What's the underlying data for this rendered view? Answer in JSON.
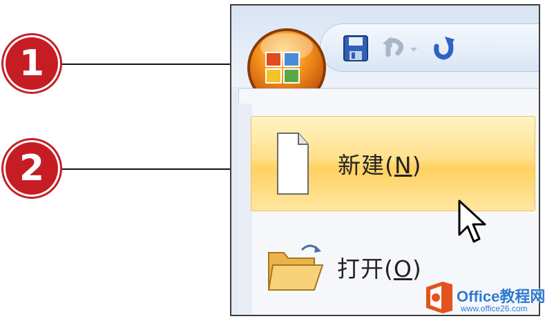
{
  "menu": {
    "items": [
      {
        "label": "新建",
        "accelerator": "N",
        "icon": "blank-document-icon",
        "highlighted": true
      },
      {
        "label": "打开",
        "accelerator": "O",
        "icon": "open-folder-icon",
        "highlighted": false
      }
    ]
  },
  "quick_access": {
    "icons": [
      "save-icon",
      "undo-icon",
      "dropdown-arrow-icon",
      "redo-icon"
    ]
  },
  "office_button": {
    "icon": "office-logo-icon"
  },
  "callouts": [
    {
      "number": "1"
    },
    {
      "number": "2"
    }
  ],
  "watermark": {
    "brand": "Office教程网",
    "url": "www.office26.com"
  },
  "colors": {
    "callout_red": "#c61d25",
    "highlight_gold": "#ffd160",
    "office_orange": "#f07a12"
  }
}
